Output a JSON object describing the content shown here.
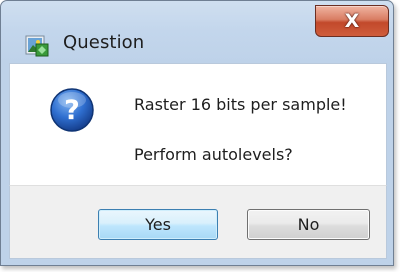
{
  "window": {
    "title": "Question",
    "app_icon": "app-icon",
    "close_icon": "close-icon",
    "close_glyph": "X"
  },
  "dialog": {
    "icon": "question-icon",
    "message_line1": "Raster 16 bits per sample!",
    "message_line2": "Perform autolevels?"
  },
  "buttons": {
    "yes_label": "Yes",
    "no_label": "No"
  },
  "colors": {
    "title_bar": "#c3d6ec",
    "close_button": "#c2492b",
    "question_icon": "#1f5fc4",
    "content_bg": "#ffffff",
    "button_bar_bg": "#f0f0f0",
    "focused_button_border": "#3c7fb1"
  }
}
